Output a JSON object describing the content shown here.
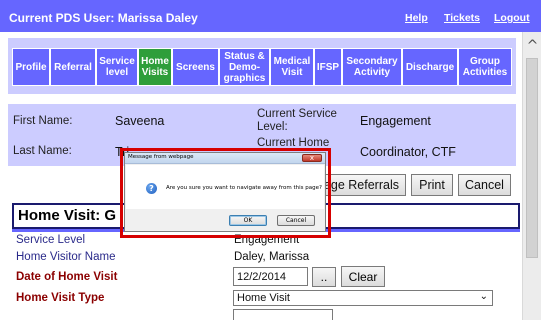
{
  "header": {
    "user_label": "Current PDS User: Marissa Daley",
    "links": {
      "help": "Help",
      "tickets": "Tickets",
      "logout": "Logout"
    }
  },
  "tabs": [
    {
      "label": "Profile",
      "active": false
    },
    {
      "label": "Referral",
      "active": false
    },
    {
      "label": "Service\nlevel",
      "active": false
    },
    {
      "label": "Home\nVisits",
      "active": true
    },
    {
      "label": "Screens",
      "active": false
    },
    {
      "label": "Status &\nDemo-\ngraphics",
      "active": false
    },
    {
      "label": "Medical\nVisit",
      "active": false
    },
    {
      "label": "IFSP",
      "active": false
    },
    {
      "label": "Secondary\nActivity",
      "active": false
    },
    {
      "label": "Discharge",
      "active": false
    },
    {
      "label": "Group\nActivities",
      "active": false
    }
  ],
  "client": {
    "first_name_label": "First Name:",
    "first_name": "Saveena",
    "last_name_label": "Last Name:",
    "last_name_partial": "Tri",
    "current_service_level_label": "Current Service Level:",
    "current_service_level": "Engagement",
    "current_home_visitor_label": "Current Home",
    "current_home_visitor": "Coordinator, CTF"
  },
  "actions": {
    "manage_referrals_partial": "age Referrals",
    "print": "Print",
    "cancel": "Cancel"
  },
  "home_visit": {
    "header_partial": "Home Visit: G",
    "service_level_label": "Service Level",
    "service_level_value": "Engagement",
    "home_visitor_label": "Home Visitor Name",
    "home_visitor_value": "Daley, Marissa",
    "date_label": "Date of Home Visit",
    "date_value": "12/2/2014",
    "date_picker_button": "..",
    "clear_button": "Clear",
    "type_label": "Home Visit Type",
    "type_value": "Home Visit"
  },
  "dialog": {
    "title": "Message from webpage",
    "message": "Are you sure you want to navigate away from this page?",
    "ok": "OK",
    "cancel": "Cancel",
    "close_glyph": "x",
    "icon": "question-icon"
  },
  "colors": {
    "header_bg": "#6666ff",
    "panel_bg": "#ccccff",
    "active_tab": "#2e9e3a",
    "highlight": "#d60000"
  }
}
